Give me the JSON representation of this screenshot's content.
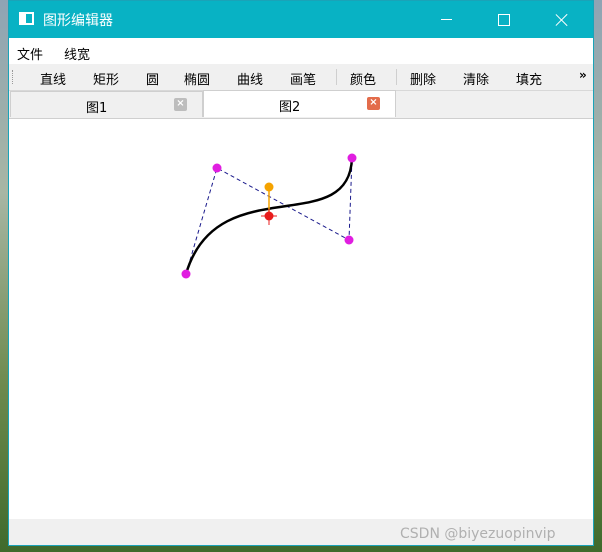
{
  "window": {
    "title": "图形编辑器",
    "title_bar_color": "#08b2c4"
  },
  "menu": {
    "items": [
      "文件",
      "线宽"
    ]
  },
  "toolbar": {
    "tools": [
      "直线",
      "矩形",
      "圆",
      "椭圆",
      "曲线",
      "画笔",
      "颜色",
      "删除",
      "清除",
      "填充"
    ],
    "overflow": "»"
  },
  "tabs": [
    {
      "label": "图1",
      "active": false
    },
    {
      "label": "图2",
      "active": true
    }
  ],
  "canvas": {
    "curve_color": "#000000",
    "control_polygon_color": "#1a1a8c",
    "control_point_color": "#e01ee0",
    "handle_color": "#f5a300",
    "center_color": "#e81c1c"
  },
  "watermark": "CSDN @biyezuopinvip"
}
